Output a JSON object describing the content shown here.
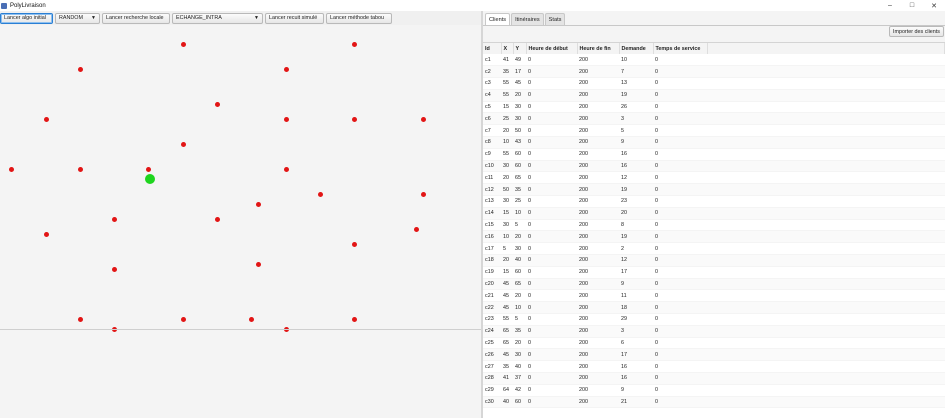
{
  "window": {
    "title": "PolyLivraison",
    "controls": [
      "–",
      "□",
      "✕"
    ]
  },
  "toolbar": {
    "btn_initial": "Lancer algo initial",
    "select_algo": "RANDOM",
    "btn_local": "Lancer recherche locale",
    "select_operator": "ECHANGE_INTRA",
    "btn_recuit": "Lancer recuit simulé",
    "btn_tabou": "Lancer méthode tabou"
  },
  "tabs": [
    "Clients",
    "Itinéraires",
    "Stats"
  ],
  "import_button": "Importer des clients",
  "table": {
    "headers": [
      "Id",
      "X",
      "Y",
      "Heure de début",
      "Heure de fin",
      "Demande",
      "Temps de service"
    ],
    "rows": [
      [
        "c1",
        "41",
        "49",
        "0",
        "200",
        "10",
        "0"
      ],
      [
        "c2",
        "35",
        "17",
        "0",
        "200",
        "7",
        "0"
      ],
      [
        "c3",
        "55",
        "45",
        "0",
        "200",
        "13",
        "0"
      ],
      [
        "c4",
        "55",
        "20",
        "0",
        "200",
        "19",
        "0"
      ],
      [
        "c5",
        "15",
        "30",
        "0",
        "200",
        "26",
        "0"
      ],
      [
        "c6",
        "25",
        "30",
        "0",
        "200",
        "3",
        "0"
      ],
      [
        "c7",
        "20",
        "50",
        "0",
        "200",
        "5",
        "0"
      ],
      [
        "c8",
        "10",
        "43",
        "0",
        "200",
        "9",
        "0"
      ],
      [
        "c9",
        "55",
        "60",
        "0",
        "200",
        "16",
        "0"
      ],
      [
        "c10",
        "30",
        "60",
        "0",
        "200",
        "16",
        "0"
      ],
      [
        "c11",
        "20",
        "65",
        "0",
        "200",
        "12",
        "0"
      ],
      [
        "c12",
        "50",
        "35",
        "0",
        "200",
        "19",
        "0"
      ],
      [
        "c13",
        "30",
        "25",
        "0",
        "200",
        "23",
        "0"
      ],
      [
        "c14",
        "15",
        "10",
        "0",
        "200",
        "20",
        "0"
      ],
      [
        "c15",
        "30",
        "5",
        "0",
        "200",
        "8",
        "0"
      ],
      [
        "c16",
        "10",
        "20",
        "0",
        "200",
        "19",
        "0"
      ],
      [
        "c17",
        "5",
        "30",
        "0",
        "200",
        "2",
        "0"
      ],
      [
        "c18",
        "20",
        "40",
        "0",
        "200",
        "12",
        "0"
      ],
      [
        "c19",
        "15",
        "60",
        "0",
        "200",
        "17",
        "0"
      ],
      [
        "c20",
        "45",
        "65",
        "0",
        "200",
        "9",
        "0"
      ],
      [
        "c21",
        "45",
        "20",
        "0",
        "200",
        "11",
        "0"
      ],
      [
        "c22",
        "45",
        "10",
        "0",
        "200",
        "18",
        "0"
      ],
      [
        "c23",
        "55",
        "5",
        "0",
        "200",
        "29",
        "0"
      ],
      [
        "c24",
        "65",
        "35",
        "0",
        "200",
        "3",
        "0"
      ],
      [
        "c25",
        "65",
        "20",
        "0",
        "200",
        "6",
        "0"
      ],
      [
        "c26",
        "45",
        "30",
        "0",
        "200",
        "17",
        "0"
      ],
      [
        "c27",
        "35",
        "40",
        "0",
        "200",
        "16",
        "0"
      ],
      [
        "c28",
        "41",
        "37",
        "0",
        "200",
        "16",
        "0"
      ],
      [
        "c29",
        "64",
        "42",
        "0",
        "200",
        "9",
        "0"
      ],
      [
        "c30",
        "40",
        "60",
        "0",
        "200",
        "21",
        "0"
      ]
    ]
  },
  "map": {
    "client_color": "#e21515",
    "depot_color": "#1ed51e"
  }
}
